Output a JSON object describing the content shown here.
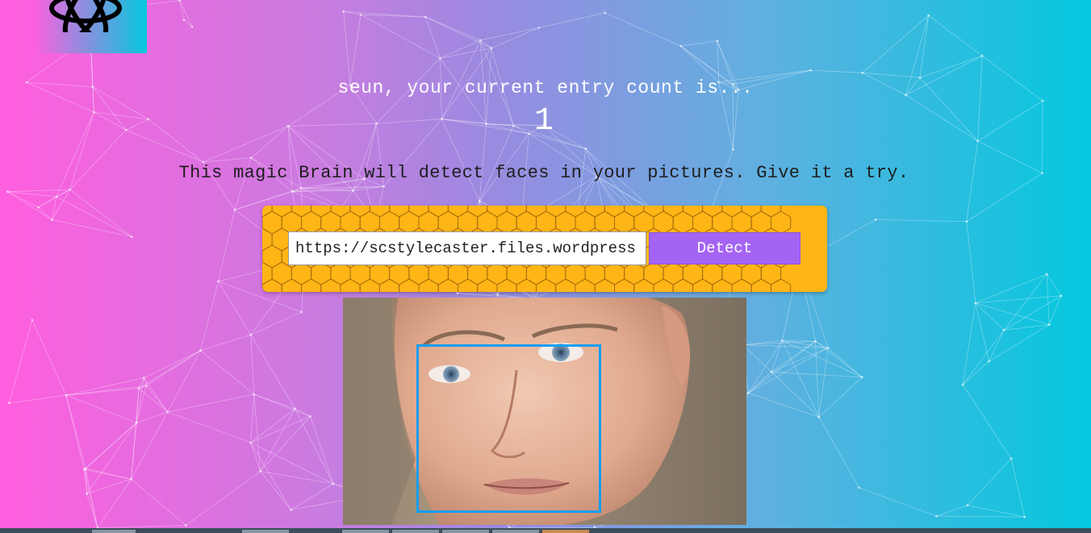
{
  "app": {
    "logo_icon": "atom-logo-icon"
  },
  "rank": {
    "entry_text": "seun, your current entry count is...",
    "entry_count": "1"
  },
  "tagline": "This magic Brain will detect faces in your pictures. Give it a try.",
  "form": {
    "url_value": "https://scstylecaster.files.wordpress.com",
    "detect_label": "Detect"
  },
  "colors": {
    "gradient_start": "#ff5edf",
    "gradient_end": "#04c8de",
    "panel_yellow": "#ffb515",
    "button_purple": "#a463f2",
    "face_box_blue": "#149df2"
  },
  "image": {
    "alt": "face photo",
    "detection_box": "face-bounding-box"
  }
}
